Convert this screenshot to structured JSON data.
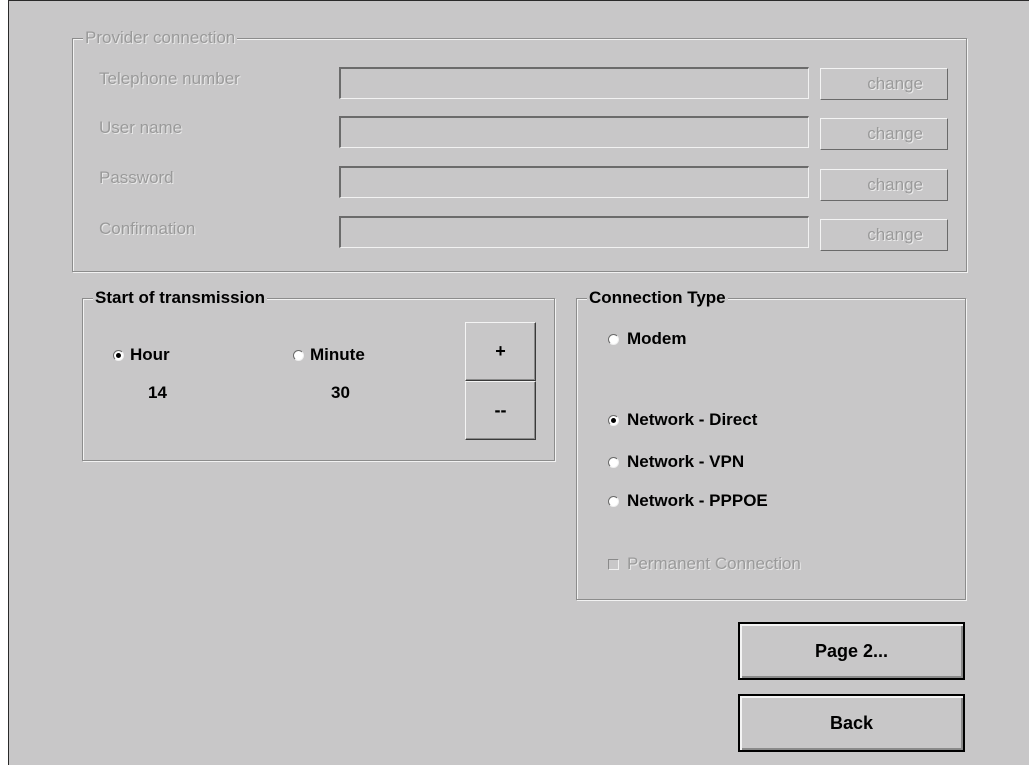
{
  "provider": {
    "title": "Provider connection",
    "rows": [
      {
        "label": "Telephone number",
        "value": "",
        "button": "change"
      },
      {
        "label": "User name",
        "value": "",
        "button": "change"
      },
      {
        "label": "Password",
        "value": "",
        "button": "change"
      },
      {
        "label": "Confirmation",
        "value": "",
        "button": "change"
      }
    ]
  },
  "transmission": {
    "title": "Start of transmission",
    "hour_label": "Hour",
    "minute_label": "Minute",
    "hour_value": "14",
    "minute_value": "30",
    "selected": "Hour",
    "plus_label": "+",
    "minus_label": "--"
  },
  "connection_type": {
    "title": "Connection Type",
    "options": [
      "Modem",
      "Network - Direct",
      "Network - VPN",
      "Network - PPPOE"
    ],
    "selected": "Network - Direct",
    "permanent_label": "Permanent Connection",
    "permanent_checked": false
  },
  "buttons": {
    "page2": "Page 2...",
    "back": "Back"
  }
}
